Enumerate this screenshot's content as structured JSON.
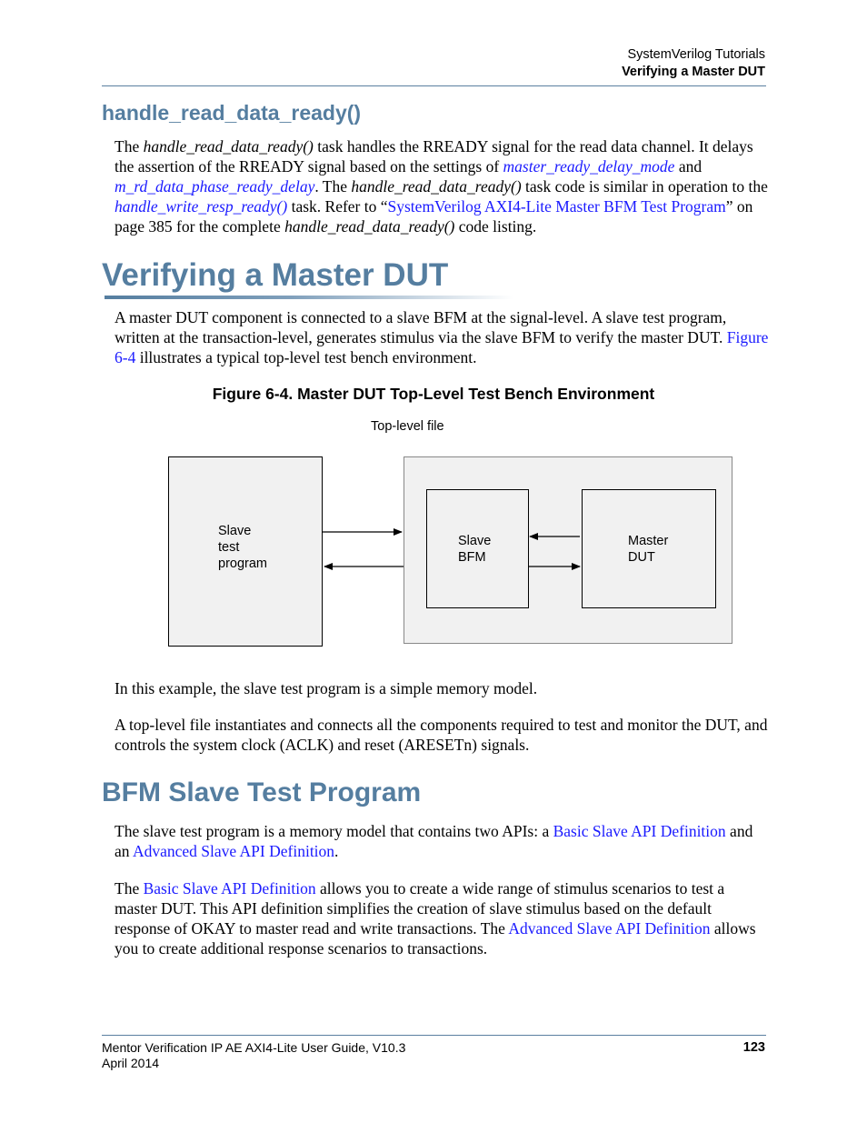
{
  "header": {
    "chapter": "SystemVerilog Tutorials",
    "section": "Verifying a Master DUT"
  },
  "section_handle": {
    "title": "handle_read_data_ready()",
    "p1": {
      "t1": "The ",
      "i1": "handle_read_data_ready()",
      "t2": " task handles the RREADY signal for the read data channel. It delays the assertion of the RREADY signal based on the settings of ",
      "link1": "master_ready_delay_mode",
      "t3": " and ",
      "link2": "m_rd_data_phase_ready_delay",
      "t4": ". The ",
      "i2": "handle_read_data_ready()",
      "t5": " task code is similar in operation to the ",
      "link3": "handle_write_resp_ready()",
      "t6": " task. Refer to “",
      "link4": "SystemVerilog AXI4-Lite Master BFM Test Program",
      "t7": "” on page 385 for the complete ",
      "i3": "handle_read_data_ready()",
      "t8": " code listing."
    }
  },
  "section_verify": {
    "title": "Verifying a Master DUT",
    "p2": {
      "t1": "A master DUT component is connected to a slave BFM at the signal-level. A slave test program, written at the transaction-level, generates stimulus via the slave BFM to verify the master DUT. ",
      "link1": "Figure 6-4",
      "t2": " illustrates a typical top-level test bench environment."
    },
    "figure": {
      "caption": "Figure 6-4. Master DUT Top-Level Test Bench Environment",
      "top_level_label": "Top-level file",
      "slave_test_program": [
        "Slave",
        "test",
        "program"
      ],
      "slave_bfm": [
        "Slave",
        "BFM"
      ],
      "master_dut": [
        "Master",
        "DUT"
      ]
    },
    "p3": "In this example, the slave test program is a simple memory model.",
    "p4": "A top-level file instantiates and connects all the components required to test and monitor the DUT, and controls the system clock (ACLK) and reset (ARESETn) signals."
  },
  "section_bfm": {
    "title": "BFM Slave Test Program",
    "p5": {
      "t1": "The slave test program is a memory model that contains two APIs: a ",
      "link1": "Basic Slave API Definition",
      "t2": " and an ",
      "link2": "Advanced Slave API Definition",
      "t3": "."
    },
    "p6": {
      "t1": "The ",
      "link1": "Basic Slave API Definition",
      "t2": " allows you to create a wide range of stimulus scenarios to test a master DUT. This API definition simplifies the creation of slave stimulus based on the default response of OKAY to master read and write transactions. The ",
      "link2": "Advanced Slave API Definition",
      "t3": " allows you to create additional response scenarios to transactions."
    }
  },
  "footer": {
    "doc_title": "Mentor Verification IP AE AXI4-Lite User Guide, V10.3",
    "date": "April 2014",
    "page_number": "123"
  },
  "colors": {
    "heading": "#557ea0",
    "link": "#1a1aff",
    "rule": "#5a7fa0",
    "box_fill": "#f1f1f1"
  }
}
